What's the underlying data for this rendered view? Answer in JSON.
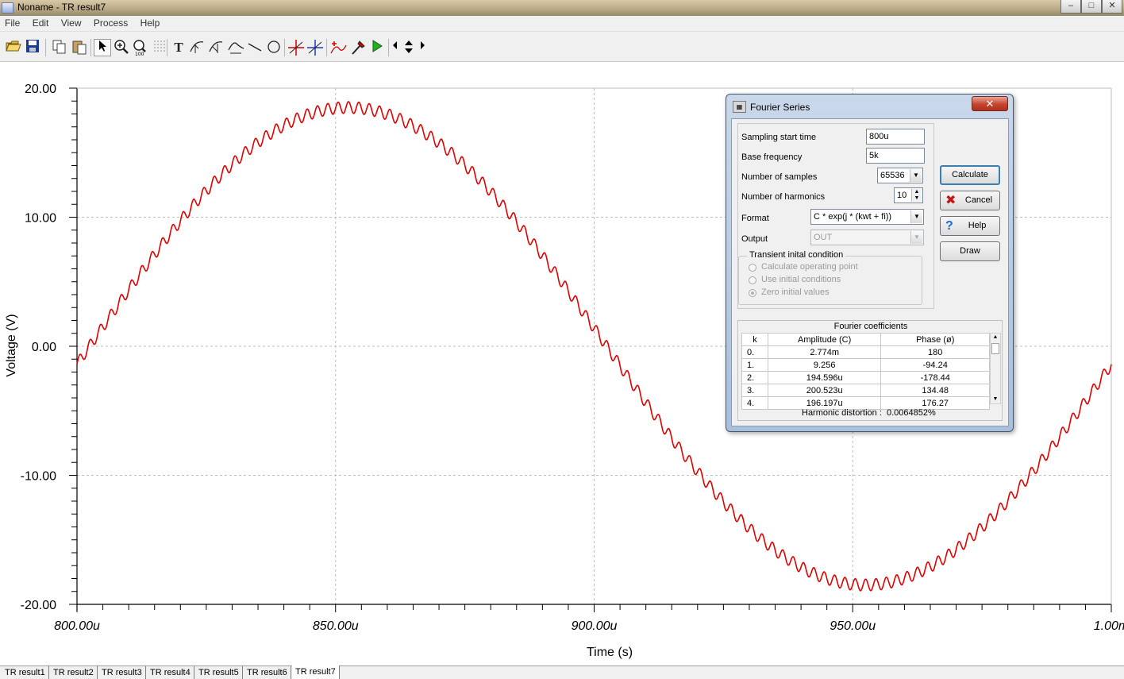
{
  "window": {
    "title": "Noname - TR result7"
  },
  "menu": [
    "File",
    "Edit",
    "View",
    "Process",
    "Help"
  ],
  "toolbar": {
    "buttons": [
      "open-folder-icon",
      "save-icon",
      "copy-icon",
      "paste-icon",
      "pointer-icon",
      "zoom-in-icon",
      "zoom-100-icon",
      "grid-icon",
      "text-icon",
      "cursor-a-icon",
      "cursor-b-icon",
      "curve-label-icon",
      "line-icon",
      "circle-icon",
      "cursor-a-cross-icon",
      "cursor-b-cross-icon",
      "add-marker-icon",
      "probe-icon",
      "run-icon",
      "nav-left-icon",
      "nav-updown-icon",
      "nav-right-icon"
    ],
    "text_glyph": "T",
    "zoom_label": "100"
  },
  "chart_data": {
    "type": "line",
    "title": "",
    "xlabel": "Time (s)",
    "ylabel": "Voltage (V)",
    "xlim": [
      800,
      1000
    ],
    "ylim": [
      -20,
      20
    ],
    "x_unit": "µs",
    "xticks": [
      "800.00u",
      "850.00u",
      "900.00u",
      "950.00u",
      "1.00m"
    ],
    "yticks": [
      "20.00",
      "10.00",
      "0.00",
      "-10.00",
      "-20.00"
    ],
    "grid": true,
    "color": "#e00000",
    "series": [
      {
        "amplitude": 18.5,
        "frequency_hz": 5000,
        "start_value": -1.4,
        "ripple_amplitude": 0.45,
        "ripple_frequency_hz": 500000,
        "x": [
          800,
          810,
          820,
          830,
          840,
          850,
          860,
          870,
          880,
          890,
          900,
          910,
          920,
          930,
          940,
          950,
          960,
          970,
          980,
          990,
          1000
        ],
        "y": [
          -1.4,
          4.4,
          9.8,
          14.3,
          17.4,
          18.5,
          17.4,
          14.3,
          9.8,
          4.4,
          -1.4,
          -7.2,
          -12.6,
          -16.5,
          -18.3,
          -18.5,
          -17.4,
          -14.3,
          -9.8,
          -4.4,
          -1.4
        ]
      }
    ]
  },
  "dialog": {
    "title": "Fourier Series",
    "close_glyph": "✕",
    "icon_text": "▦",
    "fields": {
      "sampling_start_label": "Sampling start time",
      "sampling_start_value": "800u",
      "base_freq_label": "Base frequency",
      "base_freq_value": "5k",
      "num_samples_label": "Number of samples",
      "num_samples_value": "65536",
      "num_harmonics_label": "Number of harmonics",
      "num_harmonics_value": "10",
      "format_label": "Format",
      "format_value": "C * exp(j * (kwt + fi))",
      "output_label": "Output",
      "output_value": "OUT"
    },
    "transient": {
      "title": "Transient inital condition",
      "options": [
        "Calculate operating point",
        "Use initial conditions",
        "Zero initial values"
      ],
      "selected": "Zero initial values"
    },
    "buttons": {
      "calculate": "Calculate",
      "cancel": "Cancel",
      "help": "Help",
      "draw": "Draw"
    },
    "coefficients": {
      "title": "Fourier coefficients",
      "headers": [
        "k",
        "Amplitude (C)",
        "Phase (ø)"
      ],
      "rows": [
        [
          "0.",
          "2.774m",
          "180"
        ],
        [
          "1.",
          "9.256",
          "-94.24"
        ],
        [
          "2.",
          "194.596u",
          "-178.44"
        ],
        [
          "3.",
          "200.523u",
          "134.48"
        ],
        [
          "4.",
          "196.197u",
          "176.27"
        ]
      ]
    },
    "distortion_label": "Harmonic distortion :",
    "distortion_value": "0.0064852%"
  },
  "tabs": [
    "TR result1",
    "TR result2",
    "TR result3",
    "TR result4",
    "TR result5",
    "TR result6",
    "TR result7"
  ],
  "active_tab": "TR result7"
}
